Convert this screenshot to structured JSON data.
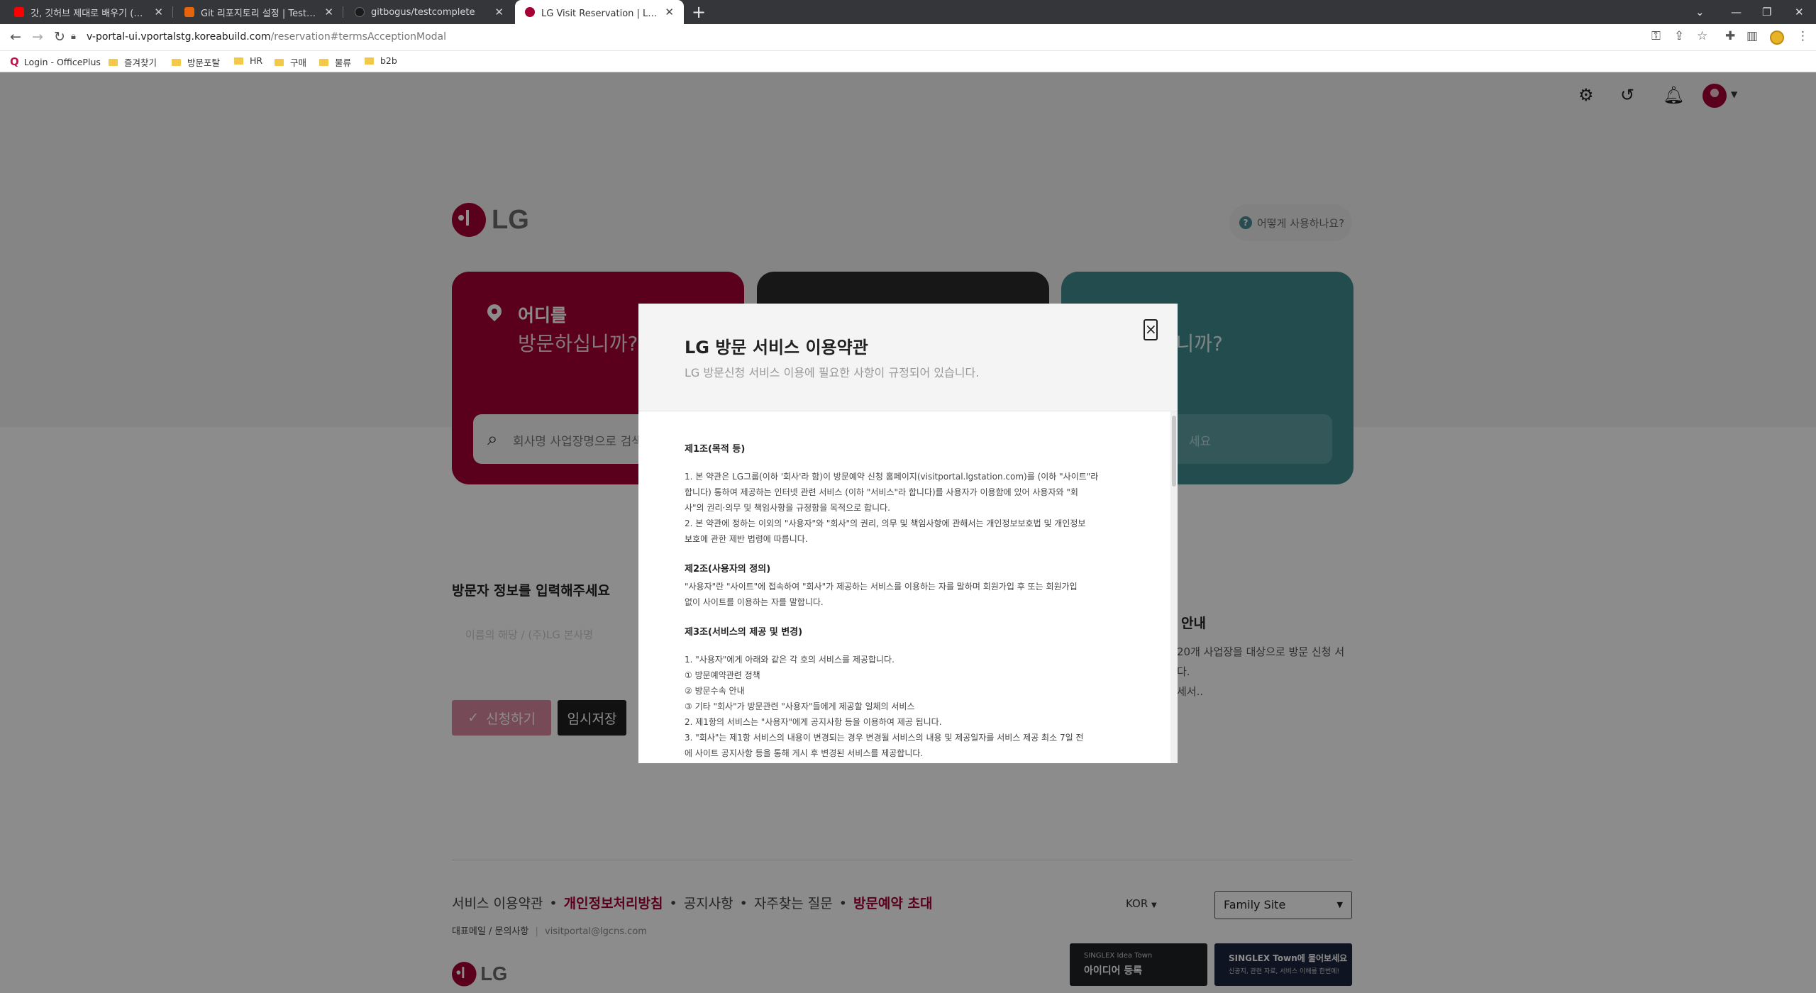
{
  "browser": {
    "tabs": [
      {
        "title": "갓, 깃허브 제대로 배우기 (기본",
        "favicon_color": "#ff0000"
      },
      {
        "title": "Git 리포지토리 설정 | TestComp",
        "favicon_color": "#e8630a"
      },
      {
        "title": "gitbogus/testcomplete",
        "favicon_color": "#222222"
      },
      {
        "title": "LG Visit Reservation | LG 방문 D",
        "favicon_color": "#a50034"
      }
    ],
    "url_host": "v-portal-ui.vportalstg.koreabuild.com",
    "url_path": "/reservation#termsAcceptionModal",
    "bookmarks": [
      "Login - OfficePlus",
      "즐겨찾기",
      "방문포탈",
      "HR",
      "구매",
      "물류",
      "b2b"
    ]
  },
  "header": {
    "logo_text": "LG",
    "help": "어떻게 사용하나요?"
  },
  "cards": {
    "where_line1": "어디를",
    "where_line2": "방문하십니까?",
    "where_placeholder": "회사명 사업장명으로 검색",
    "teal_line2": "하십니까?",
    "teal_placeholder": "세요"
  },
  "form": {
    "section_title": "방문자 정보를 입력해주세요",
    "input_hint": "이름의 해당 / (주)LG 본사명",
    "apply_button": "신청하기",
    "temp_save_button": "임시저장"
  },
  "info": {
    "title": "안내",
    "line1": "20개 사업장을 대상으로 방문 신청 서",
    "line2": "다.",
    "line3": "세서.."
  },
  "footer": {
    "links": [
      "서비스 이용약관",
      "개인정보처리방침",
      "공지사항",
      "자주찾는 질문",
      "방문예약 초대"
    ],
    "contact_label": "대표메일 / 문의사항",
    "contact_email": "visitportal@lgcns.com",
    "lang": "KOR",
    "family_site": "Family Site",
    "banner1_small": "SINGLEX Idea Town",
    "banner1_title": "아이디어 등록",
    "banner2_title": "SINGLEX Town에 물어보세요",
    "banner2_small": "신공지, 관련 자료, 서비스 이해를 한번에!"
  },
  "modal": {
    "title": "LG 방문 서비스 이용약관",
    "subtitle": "LG 방문신청 서비스 이용에 필요한 사항이 규정되어 있습니다.",
    "close": "×",
    "articles": [
      {
        "heading": "제1조(목적 등)",
        "lines": [
          "1. 본 약관은 LG그룹(이하 '회사'라 함)이 방문예약 신청 홈페이지(visitportal.lgstation.com)를 (이하 \"사이트\"라",
          "합니다) 통하여 제공하는 인터넷 관련 서비스 (이하 \"서비스\"라 합니다)를 사용자가 이용함에 있어 사용자와 \"회",
          "사\"의 권리·의무 및 책임사항을 규정함을 목적으로 합니다.",
          "2. 본 약관에 정하는 이외의 \"사용자\"와 \"회사\"의 권리, 의무 및 책임사항에 관해서는 개인정보보호법 및 개인정보",
          "보호에 관한 제반 법령에 따릅니다."
        ]
      },
      {
        "heading": "제2조(사용자의 정의)",
        "lines": [
          "\"사용자\"란 \"사이트\"에 접속하여 \"회사\"가 제공하는 서비스를 이용하는 자를 말하며 회원가입 후 또는 회원가입",
          "없이 사이트를 이용하는 자를 말합니다."
        ]
      },
      {
        "heading": "제3조(서비스의 제공 및 변경)",
        "lines": [
          "1. \"사용자\"에게 아래와 같은 각 호의 서비스를 제공합니다.",
          "① 방문예약관련 정책",
          "② 방문수속 안내",
          "③ 기타 \"회사\"가 방문관련 \"사용자\"들에게 제공할 일체의 서비스",
          "2. 제1항의 서비스는 \"사용자\"에게 공지사항 등을 이용하여 제공 됩니다.",
          "3. \"회사\"는 제1항 서비스의 내용이 변경되는 경우 변경될 서비스의 내용 및 제공일자를 서비스 제공 최소 7일 전",
          "에 사이트 공지사항 등을 통해 게시 후 변경된 서비스를 제공합니다."
        ]
      }
    ]
  }
}
